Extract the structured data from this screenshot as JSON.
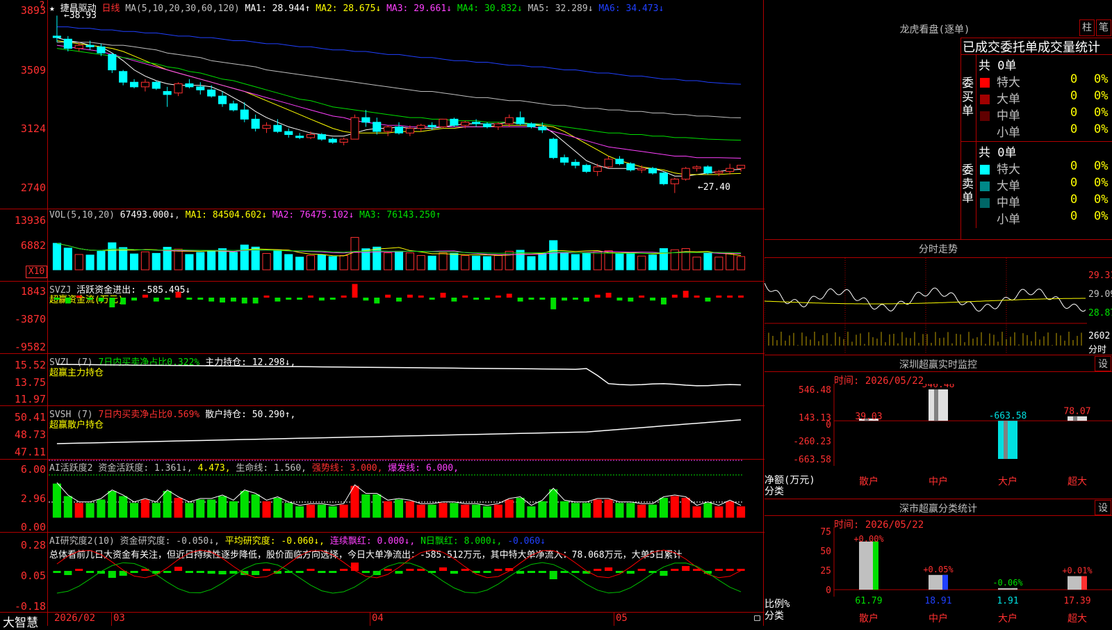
{
  "stock": {
    "name": "★ 捷昌驱动",
    "period": "日线",
    "ma_label": "MA(5,10,20,30,60,120)"
  },
  "main": {
    "ma_values": [
      {
        "label": "MA1:",
        "value": "28.944↑",
        "color": "#ffffff"
      },
      {
        "label": "MA2:",
        "value": "28.675↓",
        "color": "#ffff00"
      },
      {
        "label": "MA3:",
        "value": "29.661↓",
        "color": "#ff40ff"
      },
      {
        "label": "MA4:",
        "value": "30.832↓",
        "color": "#00e000"
      },
      {
        "label": "MA5:",
        "value": "32.289↓",
        "color": "#c0c0c0"
      },
      {
        "label": "MA6:",
        "value": "34.473↓",
        "color": "#2040ff"
      }
    ],
    "high_label": "←38.93",
    "low_label": "←27.40",
    "y_ticks": [
      "3893",
      "3509",
      "3124",
      "2740"
    ]
  },
  "vol": {
    "header": "VOL(5,10,20)",
    "value": "67493.000↓",
    "ma": [
      {
        "label": "MA1:",
        "value": "84504.602↓",
        "color": "#ffff00"
      },
      {
        "label": "MA2:",
        "value": "76475.102↓",
        "color": "#ff40ff"
      },
      {
        "label": "MA3:",
        "value": "76143.250↑",
        "color": "#00e000"
      }
    ],
    "y_ticks": [
      "13936",
      "6882"
    ],
    "unit": "X10"
  },
  "svzj": {
    "title": "SVZJ",
    "item": "活跃资金进出: -585.495↓",
    "subtitle": "超赢资金流(万元)",
    "y_ticks": [
      "1843",
      "-3870",
      "-9582"
    ]
  },
  "svzl": {
    "title": "SVZL (7)",
    "ratio": "7日内买卖净占比0.322%",
    "holding": "主力持仓: 12.298↓,",
    "subtitle": "超赢主力持仓",
    "y_ticks": [
      "15.52",
      "13.75",
      "11.97"
    ]
  },
  "svsh": {
    "title": "SVSH (7)",
    "ratio": "7日内买卖净占比0.569%",
    "holding": "散户持仓: 50.290↑,",
    "subtitle": "超赢散户持仓",
    "y_ticks": [
      "50.41",
      "48.73",
      "47.11"
    ]
  },
  "ai_active": {
    "title": "AI活跃度2",
    "items": [
      {
        "text": "资金活跃度: 1.361↓,",
        "color": "#c0c0c0"
      },
      {
        "text": "4.473,",
        "color": "#ffff00"
      },
      {
        "text": "生命线: 1.560,",
        "color": "#c0c0c0"
      },
      {
        "text": "强势线: 3.000,",
        "color": "#ff3030"
      },
      {
        "text": "爆发线: 6.000,",
        "color": "#ff40ff"
      }
    ],
    "y_ticks": [
      "6.00",
      "2.96",
      "0.00"
    ]
  },
  "ai_research": {
    "title": "AI研究度2(10)",
    "items": [
      {
        "text": "资金研究度: -0.050↓,",
        "color": "#c0c0c0"
      },
      {
        "text": "平均研究度: -0.060↓,",
        "color": "#ffff00"
      },
      {
        "text": "连续飘红: 0.000↓,",
        "color": "#ff40ff"
      },
      {
        "text": "N日飘红: 8.000↓,",
        "color": "#00e000"
      },
      {
        "text": "-0.060↓",
        "color": "#2040ff"
      }
    ],
    "summary": "总体看前几日大资金有关注，但近日持续性逐步降低，股价面临方向选择，今日大单净流出：-585.512万元，其中特大单净流入：78.068万元，大单5日累计",
    "y_ticks": [
      "0.28",
      "0.05",
      "-0.18"
    ]
  },
  "xaxis": {
    "labels": [
      "2026/02",
      "03",
      "04",
      "05"
    ],
    "brand": "大智慧"
  },
  "dragon": {
    "title": "龙虎看盘(逐单)",
    "btn1": "柱",
    "btn2": "笔",
    "tabs": "已成交委托单成交量统计",
    "buy": {
      "total": "共 0单",
      "side": "委买单",
      "rows": [
        {
          "label": "特大",
          "count": "0",
          "pct": "0%",
          "color": "#ff0000"
        },
        {
          "label": "大单",
          "count": "0",
          "pct": "0%",
          "color": "#a00000"
        },
        {
          "label": "中单",
          "count": "0",
          "pct": "0%",
          "color": "#600000"
        },
        {
          "label": "小单",
          "count": "0",
          "pct": "0%",
          "color": "#000000"
        }
      ]
    },
    "sell": {
      "total": "共 0单",
      "side": "委卖单",
      "rows": [
        {
          "label": "特大",
          "count": "0",
          "pct": "0%",
          "color": "#00ffff"
        },
        {
          "label": "大单",
          "count": "0",
          "pct": "0%",
          "color": "#008888"
        },
        {
          "label": "中单",
          "count": "0",
          "pct": "0%",
          "color": "#006666"
        },
        {
          "label": "小单",
          "count": "0",
          "pct": "0%",
          "color": "#000000"
        }
      ]
    }
  },
  "intraday": {
    "title": "分时走势",
    "y_ticks": [
      "29.31",
      "29.09",
      "28.87"
    ],
    "vol_ticks": [
      "2602",
      "分时"
    ]
  },
  "monitor": {
    "title": "深圳超赢实时监控",
    "btn": "设",
    "time": "时间: 2026/05/22",
    "ylabel": "净额(万元)",
    "xlabel": "分类"
  },
  "stats": {
    "title": "深市超赢分类统计",
    "btn": "设",
    "time": "时间: 2026/05/22",
    "ylabel": "比例%",
    "xlabel": "分类"
  },
  "chart_data": [
    {
      "type": "bar",
      "title": "深圳超赢实时监控",
      "categories": [
        "散户",
        "中户",
        "大户",
        "超大"
      ],
      "values": [
        39.03,
        546.48,
        -663.58,
        78.07
      ],
      "ylabel": "净额(万元)",
      "ylim": [
        -663.58,
        546.48
      ],
      "y_ticks": [
        "546.48",
        "143.13",
        "0",
        "-260.23",
        "-663.58"
      ],
      "colors": [
        "#e0e0e0",
        "#e0e0e0",
        "#00e0e0",
        "#e0e0e0"
      ]
    },
    {
      "type": "bar",
      "title": "深市超赢分类统计",
      "categories": [
        "散户",
        "中户",
        "大户",
        "超大"
      ],
      "series": [
        {
          "values": [
            61.79,
            18.91,
            1.91,
            17.39
          ]
        },
        {
          "values": [
            0.0,
            0.05,
            -0.06,
            0.01
          ]
        }
      ],
      "value_labels": [
        "61.79",
        "18.91",
        "1.91",
        "17.39"
      ],
      "change_labels": [
        "+0.00%",
        "+0.05%",
        "-0.06%",
        "+0.01%"
      ],
      "ylabel": "比例%",
      "ylim": [
        0,
        75
      ],
      "y_ticks": [
        "75",
        "50",
        "25",
        "0"
      ],
      "colors": [
        "#00e000",
        "#2040ff",
        "#c0c0c0",
        "#ff3030"
      ]
    },
    {
      "type": "bar",
      "title": "日线K线",
      "ylim": [
        27.4,
        38.93
      ],
      "candles_ohlc": [
        [
          37.6,
          38.93,
          37.2,
          37.5
        ],
        [
          37.4,
          37.6,
          36.6,
          36.8
        ],
        [
          36.8,
          37.2,
          36.6,
          37.0
        ],
        [
          37.0,
          37.3,
          36.7,
          36.9
        ],
        [
          36.9,
          37.1,
          36.3,
          36.5
        ],
        [
          36.4,
          36.5,
          35.2,
          35.4
        ],
        [
          35.3,
          35.4,
          34.4,
          34.6
        ],
        [
          34.6,
          34.8,
          34.2,
          34.3
        ],
        [
          34.3,
          34.8,
          34.0,
          34.6
        ],
        [
          34.6,
          34.7,
          34.1,
          34.2
        ],
        [
          34.0,
          34.3,
          33.0,
          33.8
        ],
        [
          33.9,
          34.6,
          33.7,
          34.5
        ],
        [
          34.5,
          34.8,
          34.2,
          34.3
        ],
        [
          34.3,
          34.6,
          33.8,
          34.1
        ],
        [
          34.1,
          34.4,
          33.6,
          33.7
        ],
        [
          33.7,
          34.0,
          33.0,
          33.2
        ],
        [
          33.2,
          33.4,
          32.7,
          32.8
        ],
        [
          32.8,
          33.3,
          32.0,
          32.2
        ],
        [
          32.2,
          32.5,
          31.4,
          31.6
        ],
        [
          31.6,
          32.0,
          31.3,
          31.8
        ],
        [
          31.8,
          32.2,
          31.3,
          31.4
        ],
        [
          31.4,
          31.6,
          31.0,
          31.2
        ],
        [
          31.1,
          31.3,
          30.9,
          31.0
        ],
        [
          31.0,
          31.4,
          30.9,
          31.2
        ],
        [
          31.2,
          31.3,
          30.8,
          30.9
        ],
        [
          30.9,
          31.0,
          30.6,
          30.7
        ],
        [
          30.7,
          31.0,
          30.5,
          30.9
        ],
        [
          30.9,
          32.5,
          30.9,
          32.3
        ],
        [
          32.3,
          32.8,
          31.7,
          32.0
        ],
        [
          32.0,
          32.3,
          31.2,
          31.4
        ],
        [
          31.4,
          31.8,
          31.1,
          31.7
        ],
        [
          31.7,
          32.0,
          31.2,
          31.3
        ],
        [
          31.3,
          31.8,
          31.1,
          31.6
        ],
        [
          31.6,
          31.9,
          31.4,
          31.8
        ],
        [
          31.8,
          32.0,
          31.5,
          31.7
        ],
        [
          31.7,
          32.2,
          31.6,
          32.2
        ],
        [
          32.2,
          32.3,
          31.7,
          31.8
        ],
        [
          31.8,
          32.1,
          31.6,
          32.0
        ],
        [
          32.0,
          32.2,
          31.7,
          31.9
        ],
        [
          31.9,
          32.0,
          31.6,
          31.7
        ],
        [
          31.7,
          32.0,
          31.5,
          31.9
        ],
        [
          31.9,
          32.5,
          31.7,
          32.3
        ],
        [
          32.3,
          32.7,
          31.8,
          31.9
        ],
        [
          31.9,
          32.0,
          31.6,
          31.7
        ],
        [
          31.7,
          32.0,
          31.3,
          31.5
        ],
        [
          30.9,
          31.0,
          29.6,
          29.7
        ],
        [
          29.7,
          29.9,
          29.2,
          29.4
        ],
        [
          29.4,
          29.6,
          29.0,
          29.2
        ],
        [
          29.2,
          29.3,
          28.7,
          28.8
        ],
        [
          28.8,
          29.3,
          28.5,
          29.1
        ],
        [
          29.1,
          29.8,
          29.0,
          29.6
        ],
        [
          29.6,
          29.8,
          29.2,
          29.3
        ],
        [
          29.3,
          29.4,
          28.8,
          28.9
        ],
        [
          28.9,
          29.2,
          28.7,
          29.0
        ],
        [
          29.0,
          29.1,
          28.6,
          28.7
        ],
        [
          28.7,
          28.8,
          27.9,
          28.0
        ],
        [
          28.0,
          28.4,
          27.4,
          28.3
        ],
        [
          28.3,
          29.1,
          28.2,
          29.0
        ],
        [
          29.0,
          29.2,
          28.8,
          29.1
        ],
        [
          29.1,
          29.2,
          28.6,
          28.7
        ],
        [
          28.7,
          28.9,
          28.5,
          28.8
        ],
        [
          28.8,
          29.3,
          28.6,
          29.0
        ],
        [
          29.0,
          29.2,
          28.8,
          29.2
        ]
      ],
      "ma_series": [
        {
          "name": "MA1",
          "values": [
            37.5,
            37.3,
            37.2,
            37.0,
            36.9,
            36.5,
            36.0,
            35.4,
            35.0,
            34.7,
            34.5,
            34.4,
            34.4,
            34.4,
            34.3,
            34.0,
            33.6,
            33.2,
            32.7,
            32.3,
            32.0,
            31.7,
            31.5,
            31.3,
            31.2,
            31.1,
            31.1,
            31.3,
            31.5,
            31.6,
            31.6,
            31.7,
            31.6,
            31.6,
            31.6,
            31.7,
            31.8,
            31.9,
            31.9,
            31.9,
            31.9,
            32.0,
            31.9,
            31.9,
            31.8,
            31.3,
            30.7,
            30.1,
            29.5,
            29.2,
            29.0,
            29.0,
            29.0,
            29.0,
            29.0,
            28.8,
            28.5,
            28.5,
            28.6,
            28.7,
            28.8,
            28.9,
            28.94
          ]
        },
        {
          "name": "MA2",
          "values": [
            37.3,
            37.2,
            37.1,
            37.0,
            36.9,
            36.8,
            36.6,
            36.3,
            36.0,
            35.7,
            35.4,
            35.2,
            35.0,
            34.8,
            34.6,
            34.4,
            34.2,
            34.0,
            33.7,
            33.4,
            33.1,
            32.8,
            32.5,
            32.2,
            31.9,
            31.6,
            31.4,
            31.3,
            31.3,
            31.3,
            31.3,
            31.4,
            31.4,
            31.4,
            31.5,
            31.6,
            31.6,
            31.7,
            31.7,
            31.7,
            31.8,
            31.8,
            31.8,
            31.8,
            31.8,
            31.7,
            31.4,
            31.0,
            30.6,
            30.2,
            29.8,
            29.5,
            29.3,
            29.1,
            29.0,
            28.9,
            28.7,
            28.6,
            28.6,
            28.6,
            28.6,
            28.65,
            28.675
          ]
        },
        {
          "name": "MA3",
          "values": [
            37.0,
            36.9,
            36.8,
            36.7,
            36.6,
            36.4,
            36.2,
            36.0,
            35.8,
            35.6,
            35.4,
            35.2,
            35.0,
            34.8,
            34.6,
            34.4,
            34.2,
            34.0,
            33.8,
            33.6,
            33.4,
            33.2,
            33.0,
            32.8,
            32.6,
            32.4,
            32.3,
            32.1,
            32.0,
            31.9,
            31.8,
            31.8,
            31.7,
            31.7,
            31.7,
            31.7,
            31.7,
            31.7,
            31.7,
            31.7,
            31.7,
            31.7,
            31.7,
            31.7,
            31.6,
            31.4,
            31.2,
            31.0,
            30.8,
            30.6,
            30.4,
            30.3,
            30.2,
            30.1,
            30.0,
            29.9,
            29.8,
            29.8,
            29.7,
            29.7,
            29.7,
            29.68,
            29.661
          ]
        },
        {
          "name": "MA4",
          "values": [
            36.8,
            36.7,
            36.6,
            36.5,
            36.4,
            36.3,
            36.2,
            36.1,
            35.9,
            35.8,
            35.6,
            35.5,
            35.3,
            35.2,
            35.0,
            34.8,
            34.7,
            34.5,
            34.3,
            34.1,
            33.9,
            33.7,
            33.5,
            33.4,
            33.2,
            33.0,
            32.9,
            32.8,
            32.7,
            32.6,
            32.5,
            32.4,
            32.3,
            32.3,
            32.2,
            32.2,
            32.1,
            32.1,
            32.1,
            32.0,
            32.0,
            32.0,
            32.0,
            31.9,
            31.9,
            31.8,
            31.7,
            31.6,
            31.5,
            31.4,
            31.3,
            31.3,
            31.2,
            31.2,
            31.1,
            31.1,
            31.0,
            31.0,
            30.95,
            30.9,
            30.88,
            30.85,
            30.832
          ]
        },
        {
          "name": "MA5",
          "values": [
            37.2,
            37.2,
            37.2,
            37.2,
            37.1,
            37.0,
            37.0,
            36.9,
            36.8,
            36.7,
            36.5,
            36.4,
            36.3,
            36.2,
            36.0,
            35.9,
            35.8,
            35.7,
            35.6,
            35.4,
            35.3,
            35.2,
            35.1,
            35.0,
            34.9,
            34.8,
            34.7,
            34.6,
            34.5,
            34.4,
            34.3,
            34.2,
            34.1,
            34.0,
            34.0,
            33.9,
            33.8,
            33.7,
            33.6,
            33.6,
            33.5,
            33.4,
            33.4,
            33.3,
            33.2,
            33.1,
            33.1,
            33.0,
            32.9,
            32.9,
            32.8,
            32.8,
            32.7,
            32.7,
            32.6,
            32.6,
            32.5,
            32.5,
            32.4,
            32.4,
            32.35,
            32.3,
            32.289
          ]
        },
        {
          "name": "MA6",
          "values": [
            38.2,
            38.2,
            38.1,
            38.1,
            38.0,
            38.0,
            37.9,
            37.9,
            37.8,
            37.8,
            37.7,
            37.6,
            37.6,
            37.5,
            37.5,
            37.4,
            37.3,
            37.3,
            37.2,
            37.1,
            37.1,
            37.0,
            36.9,
            36.9,
            36.8,
            36.7,
            36.7,
            36.6,
            36.6,
            36.5,
            36.4,
            36.4,
            36.3,
            36.2,
            36.2,
            36.1,
            36.0,
            36.0,
            35.9,
            35.9,
            35.8,
            35.7,
            35.7,
            35.6,
            35.6,
            35.5,
            35.4,
            35.4,
            35.3,
            35.2,
            35.2,
            35.1,
            35.0,
            35.0,
            34.9,
            34.8,
            34.8,
            34.7,
            34.7,
            34.6,
            34.55,
            34.5,
            34.473
          ]
        }
      ]
    }
  ]
}
